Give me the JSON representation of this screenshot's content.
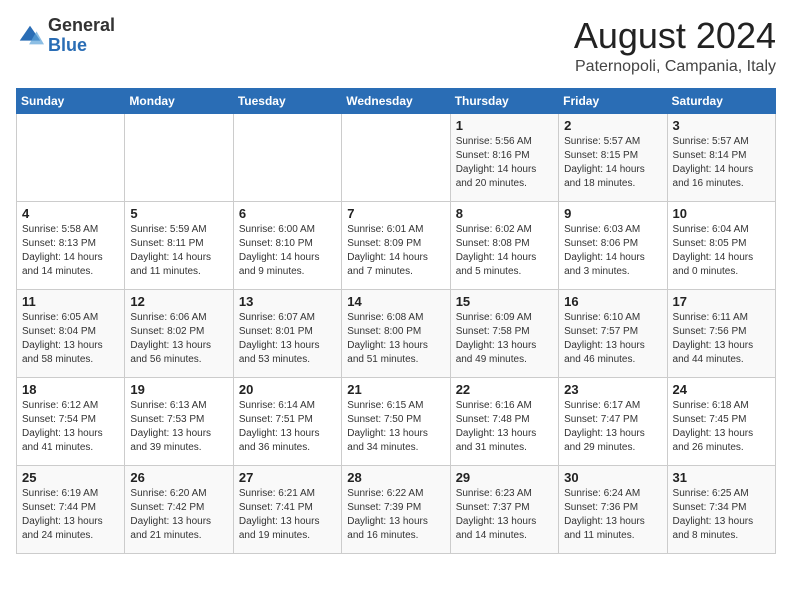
{
  "logo": {
    "general": "General",
    "blue": "Blue"
  },
  "title": "August 2024",
  "subtitle": "Paternopoli, Campania, Italy",
  "days_of_week": [
    "Sunday",
    "Monday",
    "Tuesday",
    "Wednesday",
    "Thursday",
    "Friday",
    "Saturday"
  ],
  "weeks": [
    [
      {
        "day": "",
        "info": ""
      },
      {
        "day": "",
        "info": ""
      },
      {
        "day": "",
        "info": ""
      },
      {
        "day": "",
        "info": ""
      },
      {
        "day": "1",
        "info": "Sunrise: 5:56 AM\nSunset: 8:16 PM\nDaylight: 14 hours\nand 20 minutes."
      },
      {
        "day": "2",
        "info": "Sunrise: 5:57 AM\nSunset: 8:15 PM\nDaylight: 14 hours\nand 18 minutes."
      },
      {
        "day": "3",
        "info": "Sunrise: 5:57 AM\nSunset: 8:14 PM\nDaylight: 14 hours\nand 16 minutes."
      }
    ],
    [
      {
        "day": "4",
        "info": "Sunrise: 5:58 AM\nSunset: 8:13 PM\nDaylight: 14 hours\nand 14 minutes."
      },
      {
        "day": "5",
        "info": "Sunrise: 5:59 AM\nSunset: 8:11 PM\nDaylight: 14 hours\nand 11 minutes."
      },
      {
        "day": "6",
        "info": "Sunrise: 6:00 AM\nSunset: 8:10 PM\nDaylight: 14 hours\nand 9 minutes."
      },
      {
        "day": "7",
        "info": "Sunrise: 6:01 AM\nSunset: 8:09 PM\nDaylight: 14 hours\nand 7 minutes."
      },
      {
        "day": "8",
        "info": "Sunrise: 6:02 AM\nSunset: 8:08 PM\nDaylight: 14 hours\nand 5 minutes."
      },
      {
        "day": "9",
        "info": "Sunrise: 6:03 AM\nSunset: 8:06 PM\nDaylight: 14 hours\nand 3 minutes."
      },
      {
        "day": "10",
        "info": "Sunrise: 6:04 AM\nSunset: 8:05 PM\nDaylight: 14 hours\nand 0 minutes."
      }
    ],
    [
      {
        "day": "11",
        "info": "Sunrise: 6:05 AM\nSunset: 8:04 PM\nDaylight: 13 hours\nand 58 minutes."
      },
      {
        "day": "12",
        "info": "Sunrise: 6:06 AM\nSunset: 8:02 PM\nDaylight: 13 hours\nand 56 minutes."
      },
      {
        "day": "13",
        "info": "Sunrise: 6:07 AM\nSunset: 8:01 PM\nDaylight: 13 hours\nand 53 minutes."
      },
      {
        "day": "14",
        "info": "Sunrise: 6:08 AM\nSunset: 8:00 PM\nDaylight: 13 hours\nand 51 minutes."
      },
      {
        "day": "15",
        "info": "Sunrise: 6:09 AM\nSunset: 7:58 PM\nDaylight: 13 hours\nand 49 minutes."
      },
      {
        "day": "16",
        "info": "Sunrise: 6:10 AM\nSunset: 7:57 PM\nDaylight: 13 hours\nand 46 minutes."
      },
      {
        "day": "17",
        "info": "Sunrise: 6:11 AM\nSunset: 7:56 PM\nDaylight: 13 hours\nand 44 minutes."
      }
    ],
    [
      {
        "day": "18",
        "info": "Sunrise: 6:12 AM\nSunset: 7:54 PM\nDaylight: 13 hours\nand 41 minutes."
      },
      {
        "day": "19",
        "info": "Sunrise: 6:13 AM\nSunset: 7:53 PM\nDaylight: 13 hours\nand 39 minutes."
      },
      {
        "day": "20",
        "info": "Sunrise: 6:14 AM\nSunset: 7:51 PM\nDaylight: 13 hours\nand 36 minutes."
      },
      {
        "day": "21",
        "info": "Sunrise: 6:15 AM\nSunset: 7:50 PM\nDaylight: 13 hours\nand 34 minutes."
      },
      {
        "day": "22",
        "info": "Sunrise: 6:16 AM\nSunset: 7:48 PM\nDaylight: 13 hours\nand 31 minutes."
      },
      {
        "day": "23",
        "info": "Sunrise: 6:17 AM\nSunset: 7:47 PM\nDaylight: 13 hours\nand 29 minutes."
      },
      {
        "day": "24",
        "info": "Sunrise: 6:18 AM\nSunset: 7:45 PM\nDaylight: 13 hours\nand 26 minutes."
      }
    ],
    [
      {
        "day": "25",
        "info": "Sunrise: 6:19 AM\nSunset: 7:44 PM\nDaylight: 13 hours\nand 24 minutes."
      },
      {
        "day": "26",
        "info": "Sunrise: 6:20 AM\nSunset: 7:42 PM\nDaylight: 13 hours\nand 21 minutes."
      },
      {
        "day": "27",
        "info": "Sunrise: 6:21 AM\nSunset: 7:41 PM\nDaylight: 13 hours\nand 19 minutes."
      },
      {
        "day": "28",
        "info": "Sunrise: 6:22 AM\nSunset: 7:39 PM\nDaylight: 13 hours\nand 16 minutes."
      },
      {
        "day": "29",
        "info": "Sunrise: 6:23 AM\nSunset: 7:37 PM\nDaylight: 13 hours\nand 14 minutes."
      },
      {
        "day": "30",
        "info": "Sunrise: 6:24 AM\nSunset: 7:36 PM\nDaylight: 13 hours\nand 11 minutes."
      },
      {
        "day": "31",
        "info": "Sunrise: 6:25 AM\nSunset: 7:34 PM\nDaylight: 13 hours\nand 8 minutes."
      }
    ]
  ]
}
